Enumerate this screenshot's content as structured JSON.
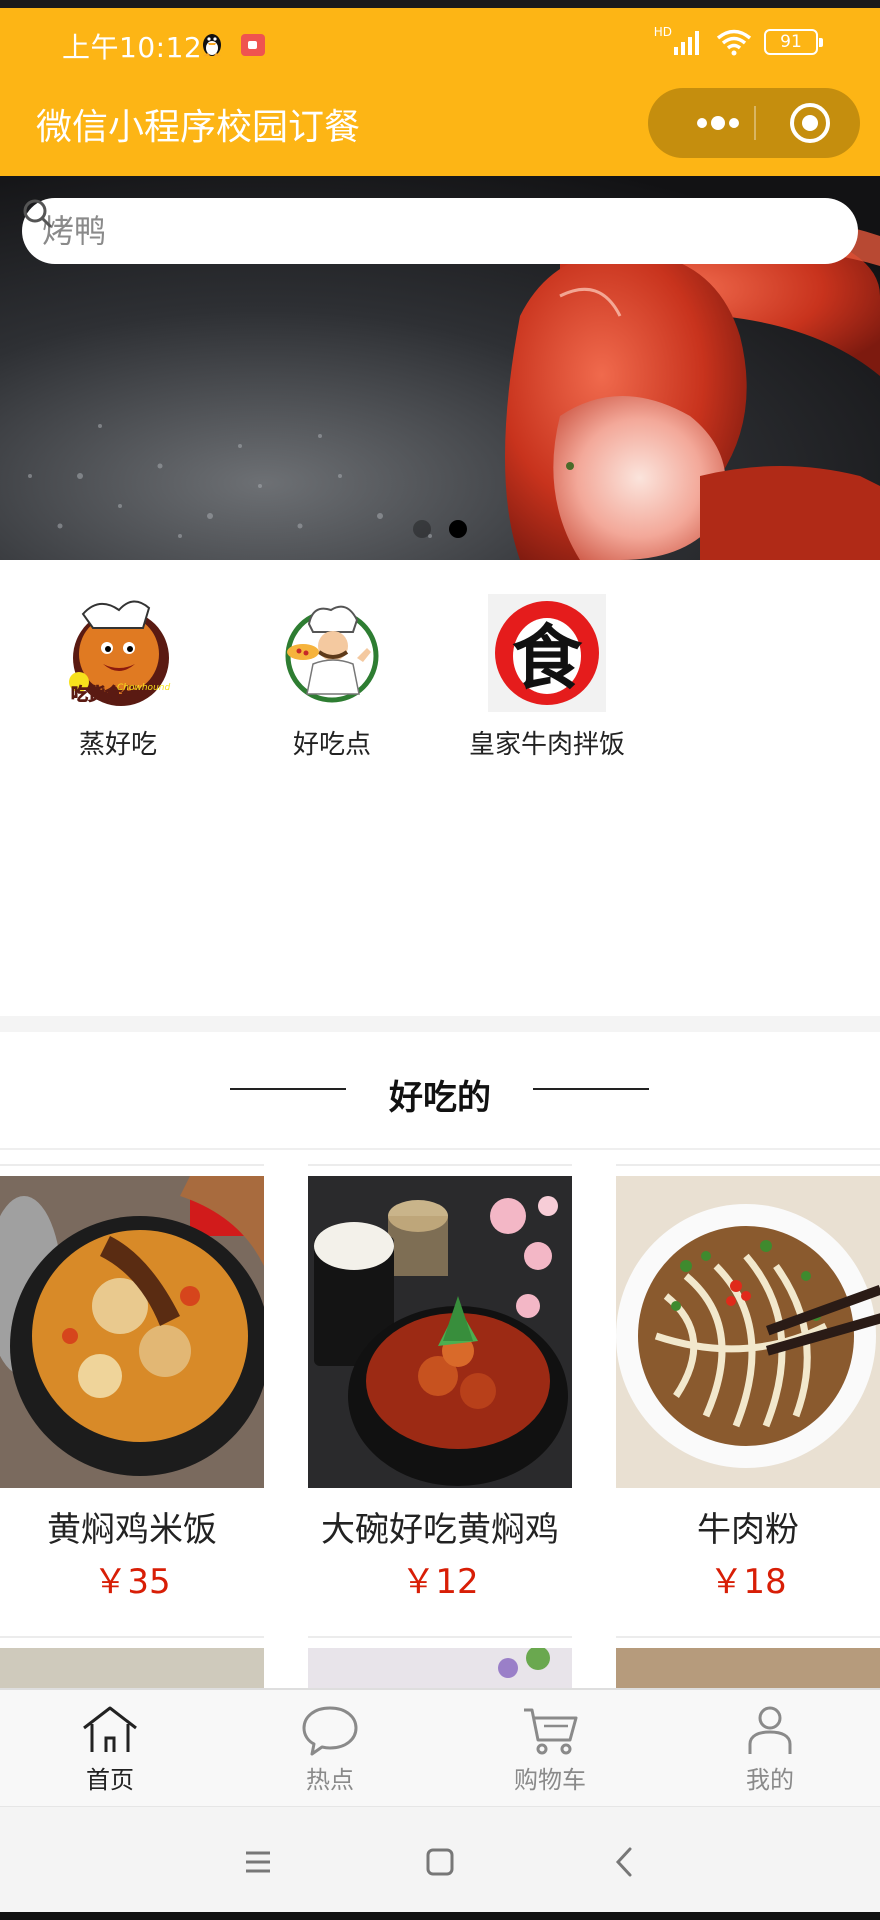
{
  "status": {
    "time": "上午10:12",
    "battery": "91",
    "network": "HD"
  },
  "header": {
    "title": "微信小程序校园订餐"
  },
  "search": {
    "placeholder": "烤鸭"
  },
  "banner": {
    "slide_count": 2,
    "active_slide": 2
  },
  "shops": [
    {
      "name": "蒸好吃",
      "logo_text": "吃货食代",
      "logo_subtext": "Chowhound"
    },
    {
      "name": "好吃点"
    },
    {
      "name": "皇家牛肉拌饭",
      "logo_text": "食"
    }
  ],
  "section": {
    "title": "好吃的"
  },
  "dishes": [
    {
      "name": "黄焖鸡米饭",
      "price": "￥35"
    },
    {
      "name": "大碗好吃黄焖鸡",
      "price": "￥12"
    },
    {
      "name": "牛肉粉",
      "price": "￥18"
    }
  ],
  "tabbar": {
    "items": [
      {
        "label": "首页",
        "icon": "home-icon",
        "active": true
      },
      {
        "label": "热点",
        "icon": "chat-bubble-icon",
        "active": false
      },
      {
        "label": "购物车",
        "icon": "cart-icon",
        "active": false
      },
      {
        "label": "我的",
        "icon": "user-icon",
        "active": false
      }
    ]
  },
  "colors": {
    "brand": "#FDB515",
    "capsule": "#C58E0E",
    "price": "#D81E06",
    "tab_active": "#222222",
    "tab_inactive": "#8A8A8A"
  }
}
